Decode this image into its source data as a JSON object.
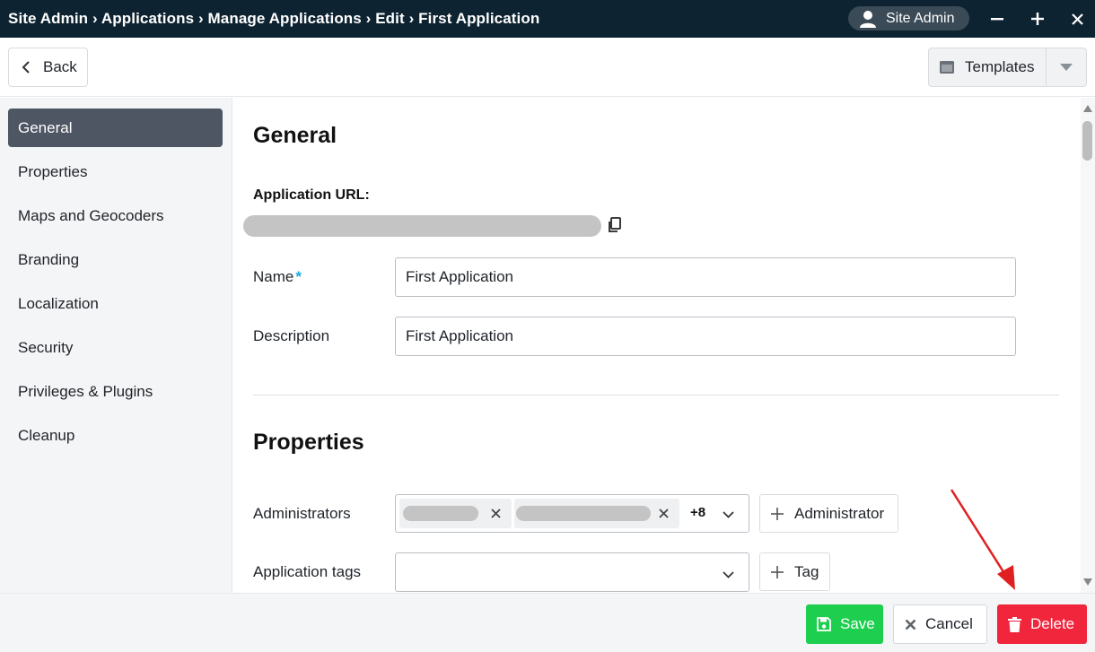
{
  "titlebar": {
    "breadcrumb": "Site Admin › Applications › Manage Applications › Edit › First Application",
    "user_label": "Site Admin",
    "minimize_glyph": "−",
    "maximize_glyph": "+",
    "close_glyph": "✕"
  },
  "toolbar": {
    "back_label": "Back",
    "templates_label": "Templates"
  },
  "sidebar": {
    "items": [
      {
        "label": "General",
        "active": true
      },
      {
        "label": "Properties",
        "active": false
      },
      {
        "label": "Maps and Geocoders",
        "active": false
      },
      {
        "label": "Branding",
        "active": false
      },
      {
        "label": "Localization",
        "active": false
      },
      {
        "label": "Security",
        "active": false
      },
      {
        "label": "Privileges & Plugins",
        "active": false
      },
      {
        "label": "Cleanup",
        "active": false
      }
    ]
  },
  "general": {
    "heading": "General",
    "url_label": "Application URL:",
    "name_label": "Name",
    "required_marker": "*",
    "name_value": "First Application",
    "description_label": "Description",
    "description_value": "First Application"
  },
  "properties": {
    "heading": "Properties",
    "administrators_label": "Administrators",
    "administrators_more": "+8",
    "add_administrator_label": "Administrator",
    "tags_label": "Application tags",
    "add_tag_label": "Tag"
  },
  "footer": {
    "save_label": "Save",
    "cancel_label": "Cancel",
    "delete_label": "Delete"
  },
  "colors": {
    "titlebar_bg": "#0e2331",
    "active_nav": "#4e5663",
    "save": "#1ecf4f",
    "delete": "#f1253b",
    "required": "#1ba6e0",
    "annotation_arrow": "#e02020"
  }
}
